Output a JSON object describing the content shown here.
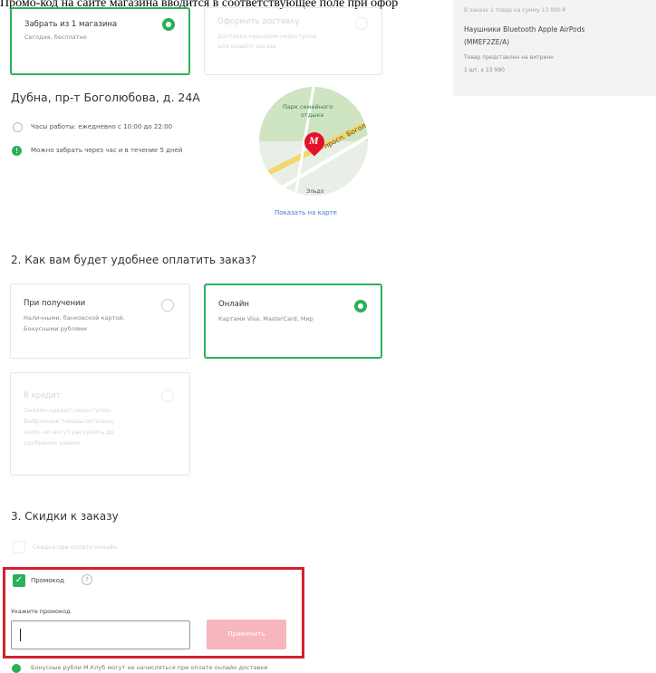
{
  "caption": "Промо-код на сайте магазина вводится в соответствующее поле при офор",
  "delivery": {
    "pickup": {
      "title": "Забрать из 1 магазина",
      "sub": "Сегодня, бесплатно"
    },
    "courier": {
      "title": "Оформить доставку",
      "sub1": "Доставка курьером недоступна",
      "sub2": "для вашего заказа"
    }
  },
  "order_summary": {
    "line1": "В заказе 1 товар на сумму 13 990 ₽",
    "product1": "Наушники Bluetooth Apple AirPods",
    "product2": "(MMEF2ZE/A)",
    "note": "Товар представлен на витрине",
    "qty": "1 шт. x 13 990"
  },
  "store": {
    "address": "Дубна, пр-т Боголюбова, д. 24А",
    "hours": "Часы работы: ежедневно с 10:00 до 22:00",
    "pickup_note": "Можно забрать через час и в течение 5 дней"
  },
  "map": {
    "park": "Парк семейного",
    "park2": "отдыха",
    "street": "просп. Боголю",
    "shop": "Эльдо",
    "link": "Показать на карте"
  },
  "payment": {
    "heading": "2. Как вам будет удобнее оплатить заказ?",
    "on_receipt": {
      "title": "При получении",
      "sub1": "Наличными, банковской картой,",
      "sub2": "Бонусными рублями"
    },
    "online": {
      "title": "Онлайн",
      "sub": "Картами Visa, MasterCard, Мир"
    },
    "credit": {
      "title": "В кредит",
      "sub1": "Онлайн-кредит недоступен.",
      "sub2": "Выбранные товары остались",
      "sub3": "мало, но могут раскупить до",
      "sub4": "одобрения заявки."
    }
  },
  "discounts": {
    "heading": "3. Скидки к заказу",
    "online_discount": "Скидка при оплате онлайн",
    "promo_label": "Промокод",
    "promo_help": "?",
    "field_label": "Укажите промокод",
    "field_value": "",
    "apply": "Применить",
    "bottom_note": "Бонусные рубли М.Клуб могут не начисляться при оплате онлайн доставки"
  },
  "colors": {
    "accent": "#2bb05a",
    "highlight": "#d5202f",
    "disabled_btn": "#f7b5bd",
    "brand": "#e4112c"
  }
}
